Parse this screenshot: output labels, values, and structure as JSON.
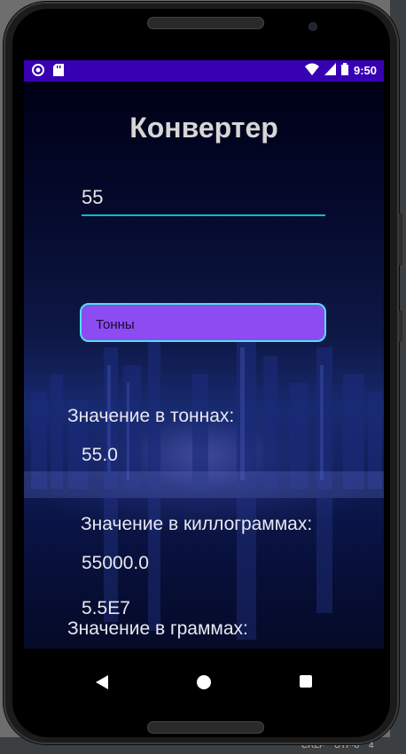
{
  "statusbar": {
    "time": "9:50",
    "icons": [
      "record-icon",
      "sd-card-icon",
      "wifi-icon",
      "signal-icon",
      "battery-icon"
    ]
  },
  "app": {
    "title": "Конвертер",
    "input_value": "55",
    "dropdown_selected": "Тонны",
    "tons_label": "Значение в тоннах:",
    "tons_value": "55.0",
    "kg_label": "Значение в киллограммах:",
    "kg_value": "55000.0",
    "grams_label": "Значение в граммах:",
    "grams_value": "5.5E7"
  },
  "navbar": {
    "icons": [
      "back-icon",
      "home-icon",
      "recents-icon"
    ]
  },
  "ide": {
    "status_items": [
      "CRLF",
      "UTF-8",
      "4"
    ]
  },
  "colors": {
    "statusbar": "#3700b3",
    "input_underline": "#14b8c4",
    "dropdown_bg": "#8c4cf2",
    "dropdown_border": "#4fe1f0"
  }
}
